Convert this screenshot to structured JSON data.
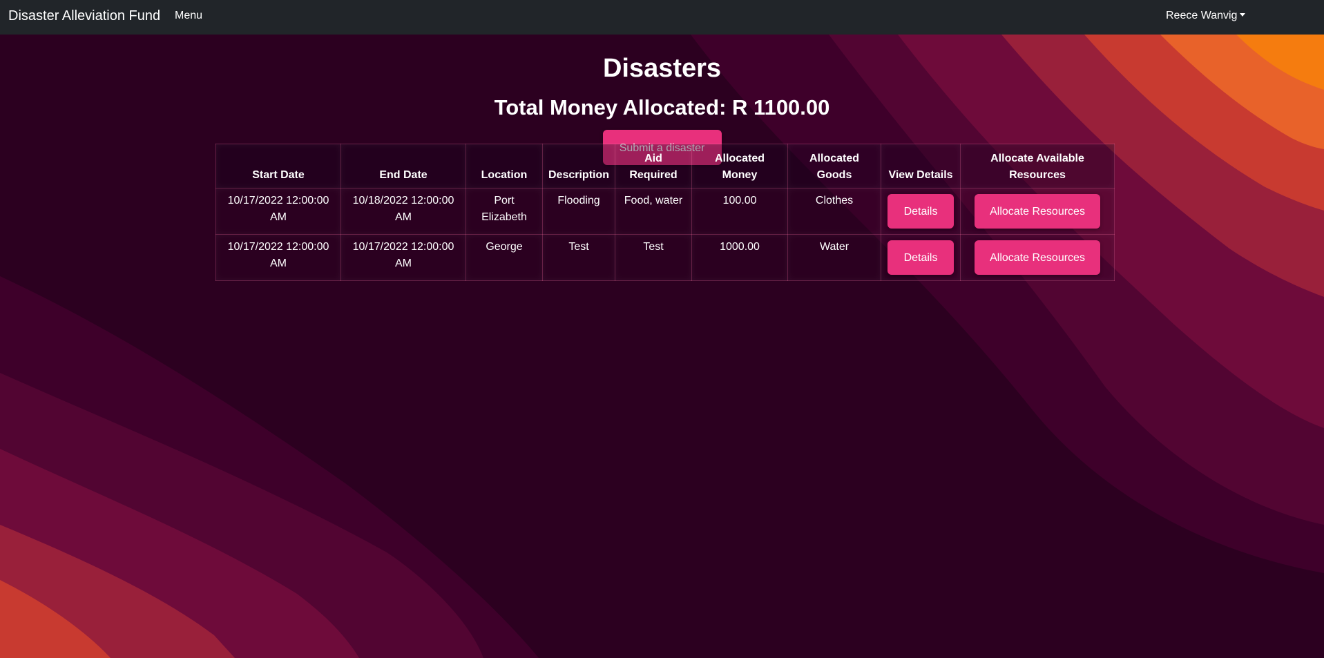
{
  "navbar": {
    "brand": "Disaster Alleviation Fund",
    "menu_label": "Menu",
    "user_name": "Reece Wanvig"
  },
  "page": {
    "title": "Disasters",
    "total_label": "Total Money Allocated: R 1100.00",
    "submit_button": "Submit a disaster"
  },
  "table": {
    "headers": {
      "start_date": "Start Date",
      "end_date": "End Date",
      "location": "Location",
      "description": "Description",
      "aid_required": "Aid Required",
      "allocated_money": "Allocated Money",
      "allocated_goods": "Allocated Goods",
      "view_details": "View Details",
      "allocate_resources": "Allocate Available Resources"
    },
    "rows": [
      {
        "start_date": "10/17/2022 12:00:00 AM",
        "end_date": "10/18/2022 12:00:00 AM",
        "location": "Port Elizabeth",
        "description": "Flooding",
        "aid_required": "Food, water",
        "allocated_money": "100.00",
        "allocated_goods": "Clothes",
        "details_button": "Details",
        "allocate_button": "Allocate Resources"
      },
      {
        "start_date": "10/17/2022 12:00:00 AM",
        "end_date": "10/17/2022 12:00:00 AM",
        "location": "George",
        "description": "Test",
        "aid_required": "Test",
        "allocated_money": "1000.00",
        "allocated_goods": "Water",
        "details_button": "Details",
        "allocate_button": "Allocate Resources"
      }
    ]
  },
  "icons": {
    "user_dropdown": "caret-down-icon"
  },
  "colors": {
    "navbar_bg": "#212529",
    "accent_button": "#e8307c",
    "background_dark": "#2c0020",
    "wave_orange": "#f57c0f"
  }
}
